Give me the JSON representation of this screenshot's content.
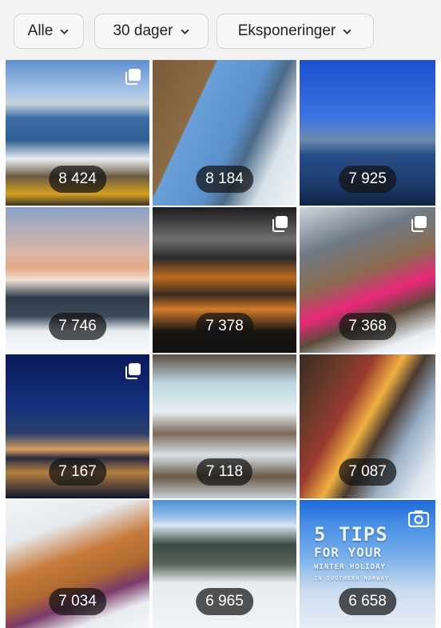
{
  "filters": [
    {
      "label": "Alle"
    },
    {
      "label": "30 dager"
    },
    {
      "label": "Eksponeringer"
    }
  ],
  "posts": [
    {
      "value": "8 424",
      "type": "carousel"
    },
    {
      "value": "8 184",
      "type": "photo"
    },
    {
      "value": "7 925",
      "type": "photo"
    },
    {
      "value": "7 746",
      "type": "photo"
    },
    {
      "value": "7 378",
      "type": "carousel"
    },
    {
      "value": "7 368",
      "type": "carousel"
    },
    {
      "value": "7 167",
      "type": "carousel"
    },
    {
      "value": "7 118",
      "type": "photo"
    },
    {
      "value": "7 087",
      "type": "photo"
    },
    {
      "value": "7 034",
      "type": "photo"
    },
    {
      "value": "6 965",
      "type": "photo"
    },
    {
      "value": "6 658",
      "type": "video",
      "overlay": {
        "line1": "5 TIPS",
        "line2": "FOR YOUR",
        "line3": "WINTER HOLIDAY",
        "line4": "IN SOUTHERN NORWAY"
      }
    }
  ],
  "icons": {
    "dropdown": "chevron-down-icon",
    "carousel": "multiple-images-icon",
    "video": "camera-icon"
  }
}
